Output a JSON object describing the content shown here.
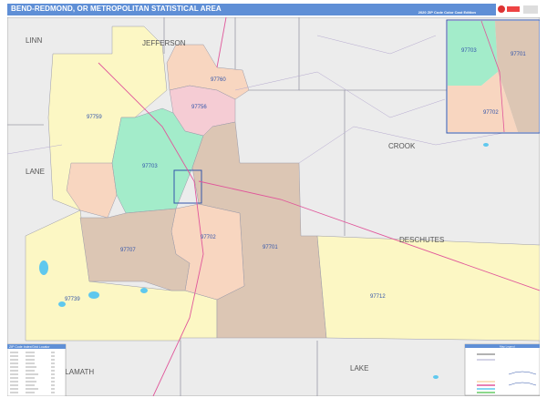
{
  "header": {
    "title": "BEND-REDMOND, OR METROPOLITAN STATISTICAL AREA",
    "subtitle": "2020 ZIP Code Color Cast Edition",
    "logo_text": "Market MAPS"
  },
  "counties": [
    "JEFFERSON",
    "LINN",
    "LANE",
    "CROOK",
    "DESCHUTES",
    "KLAMATH",
    "LAKE"
  ],
  "zips": [
    "97760",
    "97756",
    "97759",
    "97703",
    "97702",
    "97707",
    "97701",
    "97739",
    "97712"
  ],
  "inset_zips": [
    "97703",
    "97701",
    "97702"
  ],
  "legend_left": {
    "title": "ZIP Code Index/Grid Locator"
  },
  "legend_right": {
    "title": "Map Legend"
  },
  "colors": {
    "header": "#5f8fd6",
    "background": "#ececec",
    "yellow": "#fcf7c4",
    "tan": "#dcc6b4",
    "peach": "#f8d6c0",
    "pink": "#f5ccd4",
    "mint": "#a3ecca",
    "water": "#5fc8ee",
    "road": "#e0569a",
    "border": "#9a9aa8"
  }
}
